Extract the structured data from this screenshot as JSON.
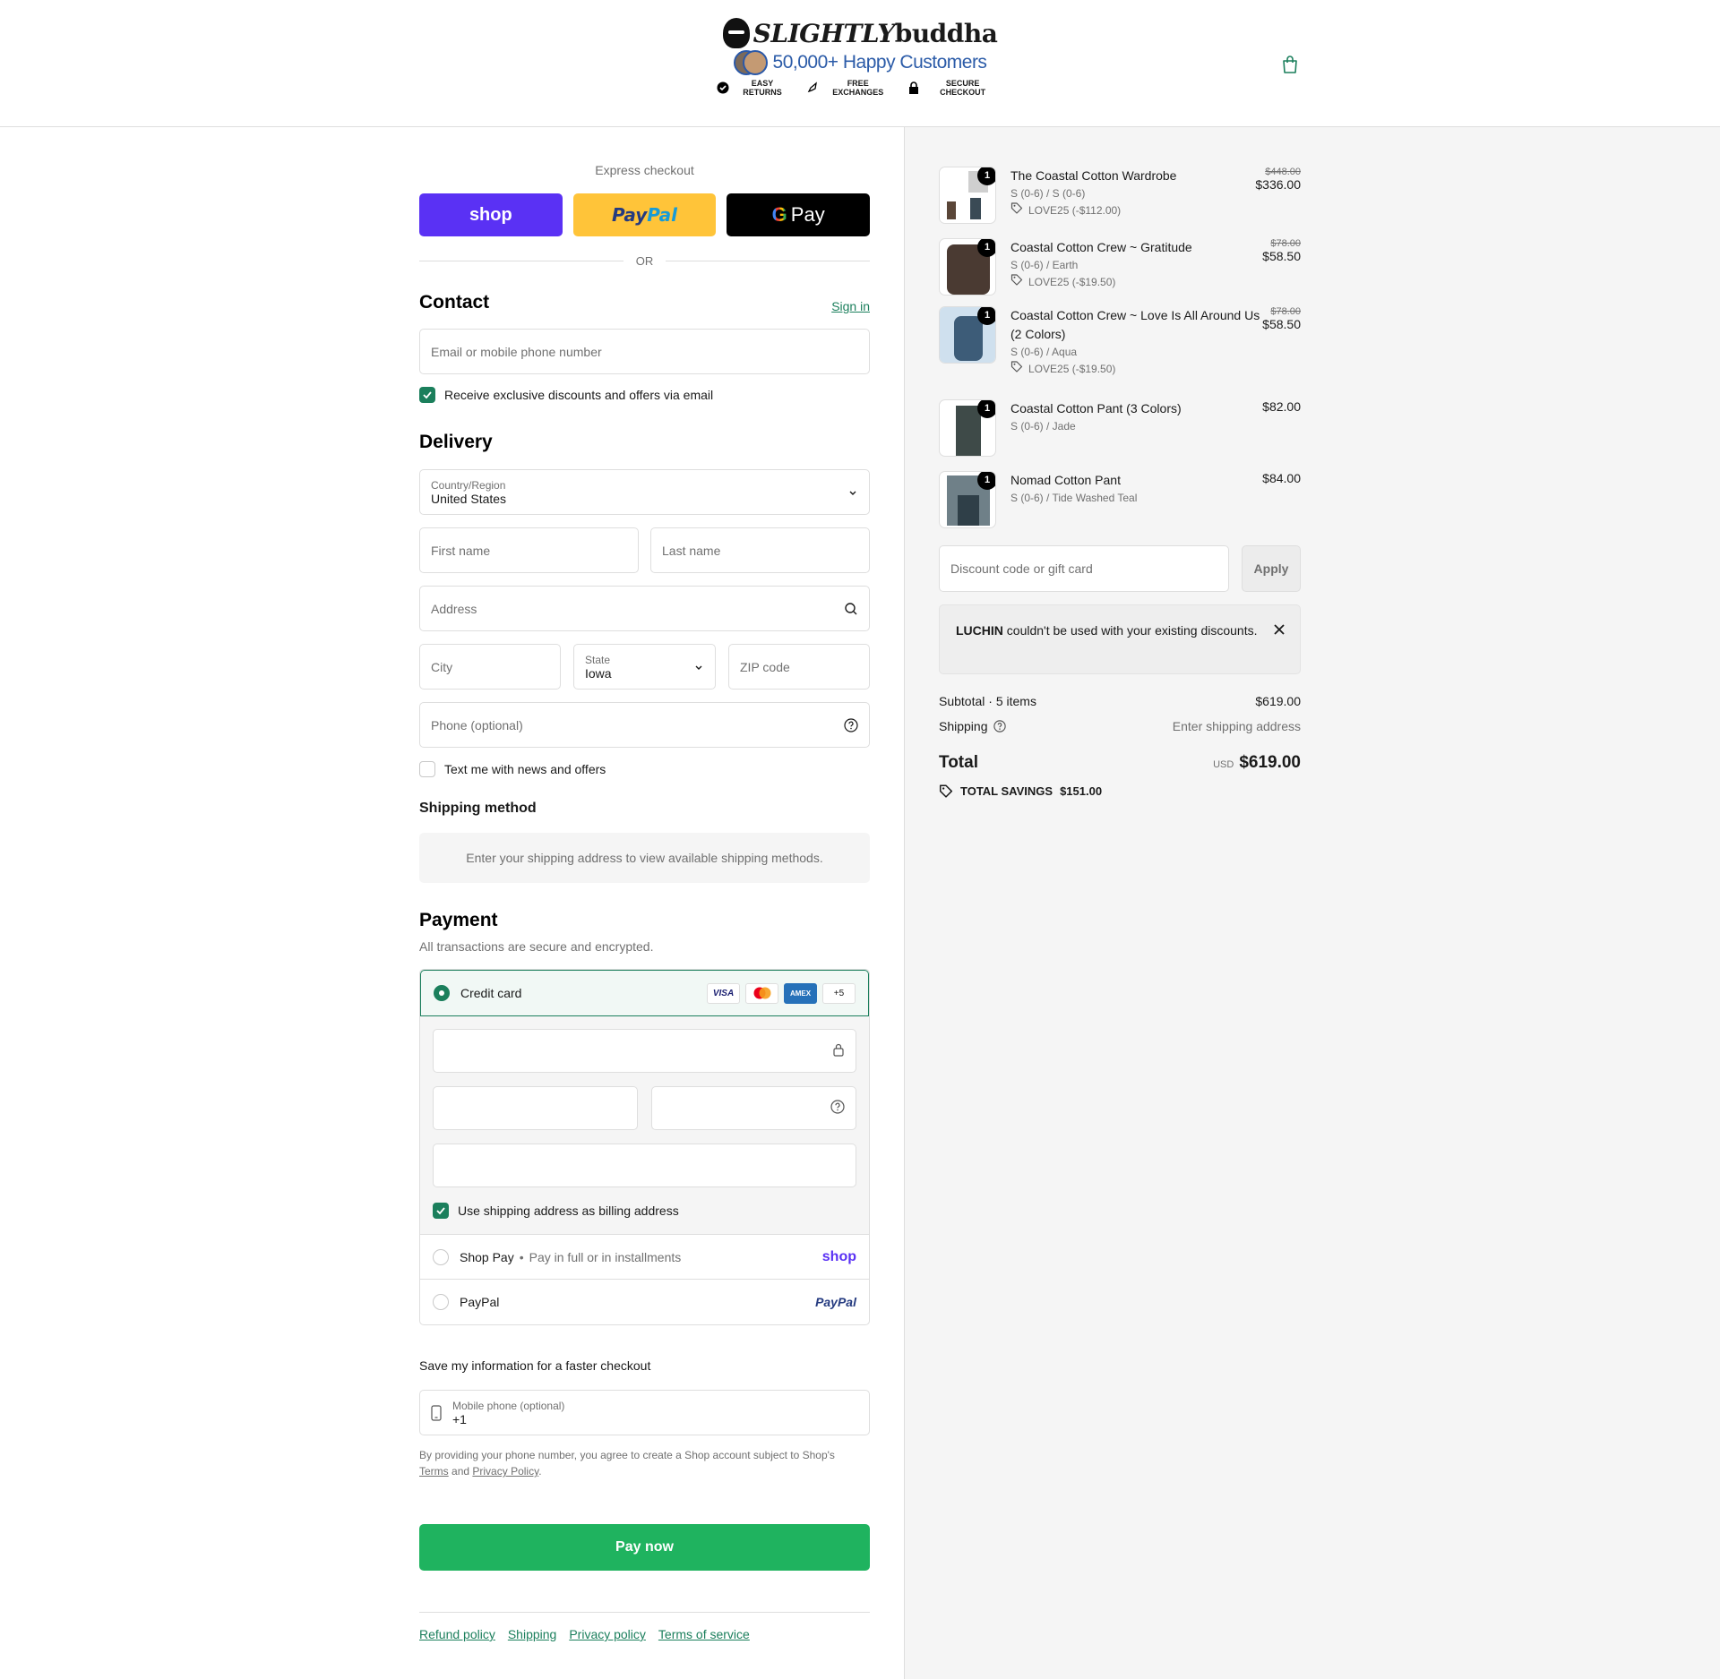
{
  "header": {
    "brand_script": "SLIGHTLY",
    "brand_word": "buddha",
    "happy_text": "50,000+ Happy Customers",
    "badges": [
      {
        "label": "EASY RETURNS",
        "icon": "check-circle-icon"
      },
      {
        "label": "FREE EXCHANGES",
        "icon": "rocket-icon"
      },
      {
        "label": "SECURE CHECKOUT",
        "icon": "lock-icon"
      }
    ],
    "cart_icon": "shopping-bag-icon"
  },
  "express": {
    "title": "Express checkout",
    "shop_label": "shop",
    "paypal_label": "PayPal",
    "gpay_label": "Pay",
    "or_label": "OR"
  },
  "contact": {
    "title": "Contact",
    "sign_in": "Sign in",
    "email_placeholder": "Email or mobile phone number",
    "offers_label": "Receive exclusive discounts and offers via email"
  },
  "delivery": {
    "title": "Delivery",
    "country_label": "Country/Region",
    "country_value": "United States",
    "first_name": "First name",
    "last_name": "Last name",
    "address": "Address",
    "city": "City",
    "state_label": "State",
    "state_value": "Iowa",
    "zip": "ZIP code",
    "phone": "Phone (optional)",
    "text_offers": "Text me with news and offers"
  },
  "shipping_method": {
    "title": "Shipping method",
    "message": "Enter your shipping address to view available shipping methods."
  },
  "payment": {
    "title": "Payment",
    "subtitle": "All transactions are secure and encrypted.",
    "credit_card": "Credit card",
    "cards": [
      "VISA",
      "MC",
      "AMEX",
      "+5"
    ],
    "billing_label": "Use shipping address as billing address",
    "shop_pay": "Shop Pay",
    "shop_pay_sub": "Pay in full or in installments",
    "shop_logo": "shop",
    "paypal": "PayPal",
    "paypal_logo": "PayPal"
  },
  "save_info": {
    "title": "Save my information for a faster checkout",
    "phone_label": "Mobile phone (optional)",
    "phone_value": "+1",
    "legal_prefix": "By providing your phone number, you agree to create a Shop account subject to Shop's",
    "terms": "Terms",
    "and": "and",
    "privacy": "Privacy Policy",
    "period": "."
  },
  "pay_now": "Pay now",
  "footer_links": [
    "Refund policy",
    "Shipping",
    "Privacy policy",
    "Terms of service"
  ],
  "order": {
    "items": [
      {
        "name": "The Coastal Cotton Wardrobe",
        "variant": "S (0-6) / S (0-6)",
        "discount": "LOVE25 (-$112.00)",
        "old_price": "$448.00",
        "price": "$336.00",
        "qty": "1"
      },
      {
        "name": "Coastal Cotton Crew ~ Gratitude",
        "variant": "S (0-6) / Earth",
        "discount": "LOVE25 (-$19.50)",
        "old_price": "$78.00",
        "price": "$58.50",
        "qty": "1"
      },
      {
        "name": "Coastal Cotton Crew ~ Love Is All Around Us (2 Colors)",
        "variant": "S (0-6) / Aqua",
        "discount": "LOVE25 (-$19.50)",
        "old_price": "$78.00",
        "price": "$58.50",
        "qty": "1"
      },
      {
        "name": "Coastal Cotton Pant (3 Colors)",
        "variant": "S (0-6) / Jade",
        "discount": "",
        "old_price": "",
        "price": "$82.00",
        "qty": "1"
      },
      {
        "name": "Nomad Cotton Pant",
        "variant": "S (0-6) / Tide Washed Teal",
        "discount": "",
        "old_price": "",
        "price": "$84.00",
        "qty": "1"
      }
    ],
    "discount_placeholder": "Discount code or gift card",
    "apply": "Apply",
    "warning_code": "LUCHIN",
    "warning_text": " couldn't be used with your existing discounts.",
    "subtotal_label": "Subtotal · 5 items",
    "subtotal_value": "$619.00",
    "shipping_label": "Shipping",
    "shipping_value": "Enter shipping address",
    "total_label": "Total",
    "currency": "USD",
    "total_value": "$619.00",
    "savings_label": "TOTAL SAVINGS",
    "savings_value": "$151.00"
  },
  "colors": {
    "accent": "#1b7f5c",
    "pay_now": "#1fb35f",
    "shop_purple": "#5a31f4",
    "paypal_yellow": "#ffc439"
  }
}
